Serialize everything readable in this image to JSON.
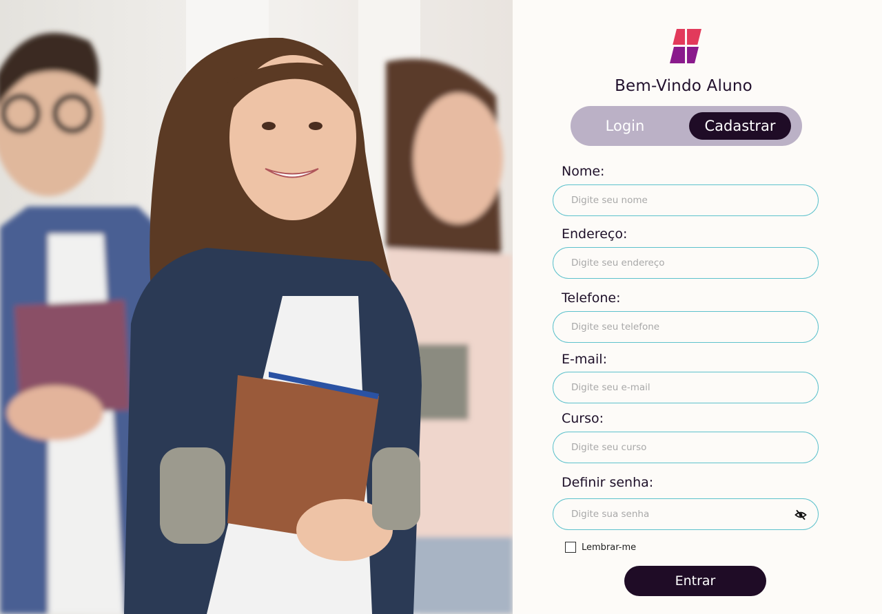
{
  "page": {
    "welcome": "Bem-Vindo Aluno",
    "colors": {
      "accent": "#1f0c26",
      "toggle_bg": "#bbb1c6",
      "field_border": "#5cc1cc",
      "logo_top": "#e23a5b",
      "logo_bottom": "#8a1a8c"
    }
  },
  "toggle": {
    "login_label": "Login",
    "signup_label": "Cadastrar",
    "active": "Cadastrar"
  },
  "form": {
    "name": {
      "label": "Nome:",
      "placeholder": "Digite seu nome",
      "value": ""
    },
    "address": {
      "label": "Endereço:",
      "placeholder": "Digite seu endereço",
      "value": ""
    },
    "phone": {
      "label": "Telefone:",
      "placeholder": "Digite seu telefone",
      "value": ""
    },
    "email": {
      "label": "E-mail:",
      "placeholder": "Digite seu e-mail",
      "value": ""
    },
    "course": {
      "label": "Curso:",
      "placeholder": "Digite seu curso",
      "value": ""
    },
    "password": {
      "label": "Definir senha:",
      "placeholder": "Digite sua senha",
      "value": "",
      "visibility_icon": "eye-off-icon"
    },
    "remember_label": "Lembrar-me",
    "remember_checked": false,
    "submit_label": "Entrar"
  }
}
